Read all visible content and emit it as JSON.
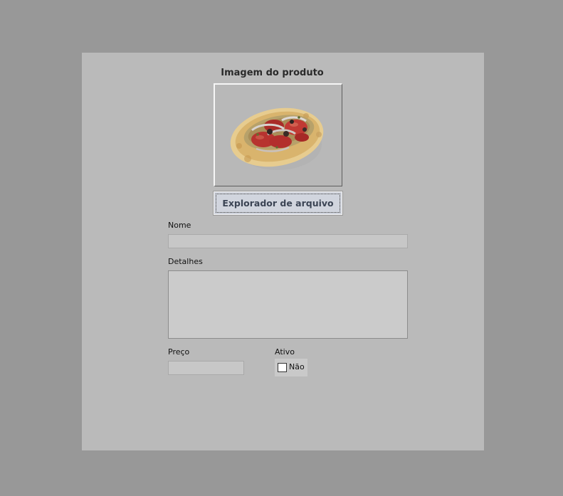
{
  "product_form": {
    "image_section_title": "Imagem do produto",
    "file_explorer_button": "Explorador de arquivo",
    "name_label": "Nome",
    "name_value": "",
    "details_label": "Detalhes",
    "details_value": "",
    "price_label": "Preço",
    "price_value": "",
    "active_label": "Ativo",
    "active_checkbox_label": "Não",
    "active_checked": false,
    "product_image": "pizza-photo"
  },
  "colors": {
    "background": "#989898",
    "panel": "#bababa",
    "button": "#d1d5de",
    "input": "#c7c7c7"
  }
}
